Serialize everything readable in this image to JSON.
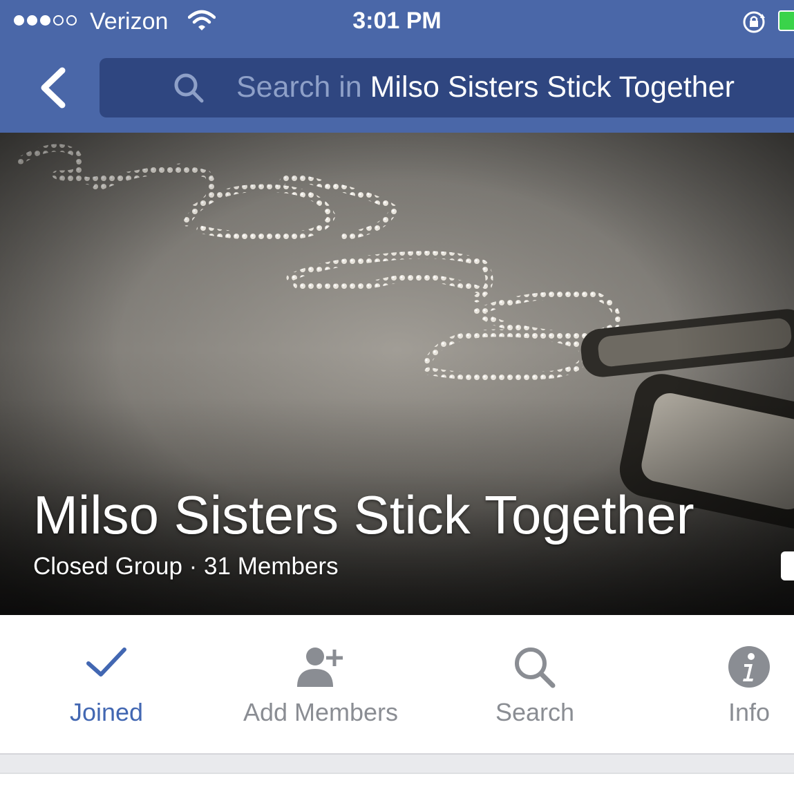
{
  "status_bar": {
    "carrier": "Verizon",
    "time": "3:01 PM",
    "signal_full": 3,
    "signal_total": 5
  },
  "nav": {
    "search_prefix": "Search in ",
    "search_group": "Milso Sisters Stick Together"
  },
  "group": {
    "name": "Milso Sisters Stick Together",
    "meta": "Closed Group · 31 Members"
  },
  "actions": [
    {
      "label": "Joined",
      "icon": "checkmark-icon",
      "active": true
    },
    {
      "label": "Add Members",
      "icon": "add-member-icon",
      "active": false
    },
    {
      "label": "Search",
      "icon": "search-icon",
      "active": false
    },
    {
      "label": "Info",
      "icon": "info-icon",
      "active": false
    }
  ],
  "colors": {
    "nav_blue": "#4a67a8",
    "search_box": "#2f4680",
    "active_blue": "#4267b2",
    "inactive_gray": "#8a8d93",
    "battery_green": "#3ad34a"
  }
}
